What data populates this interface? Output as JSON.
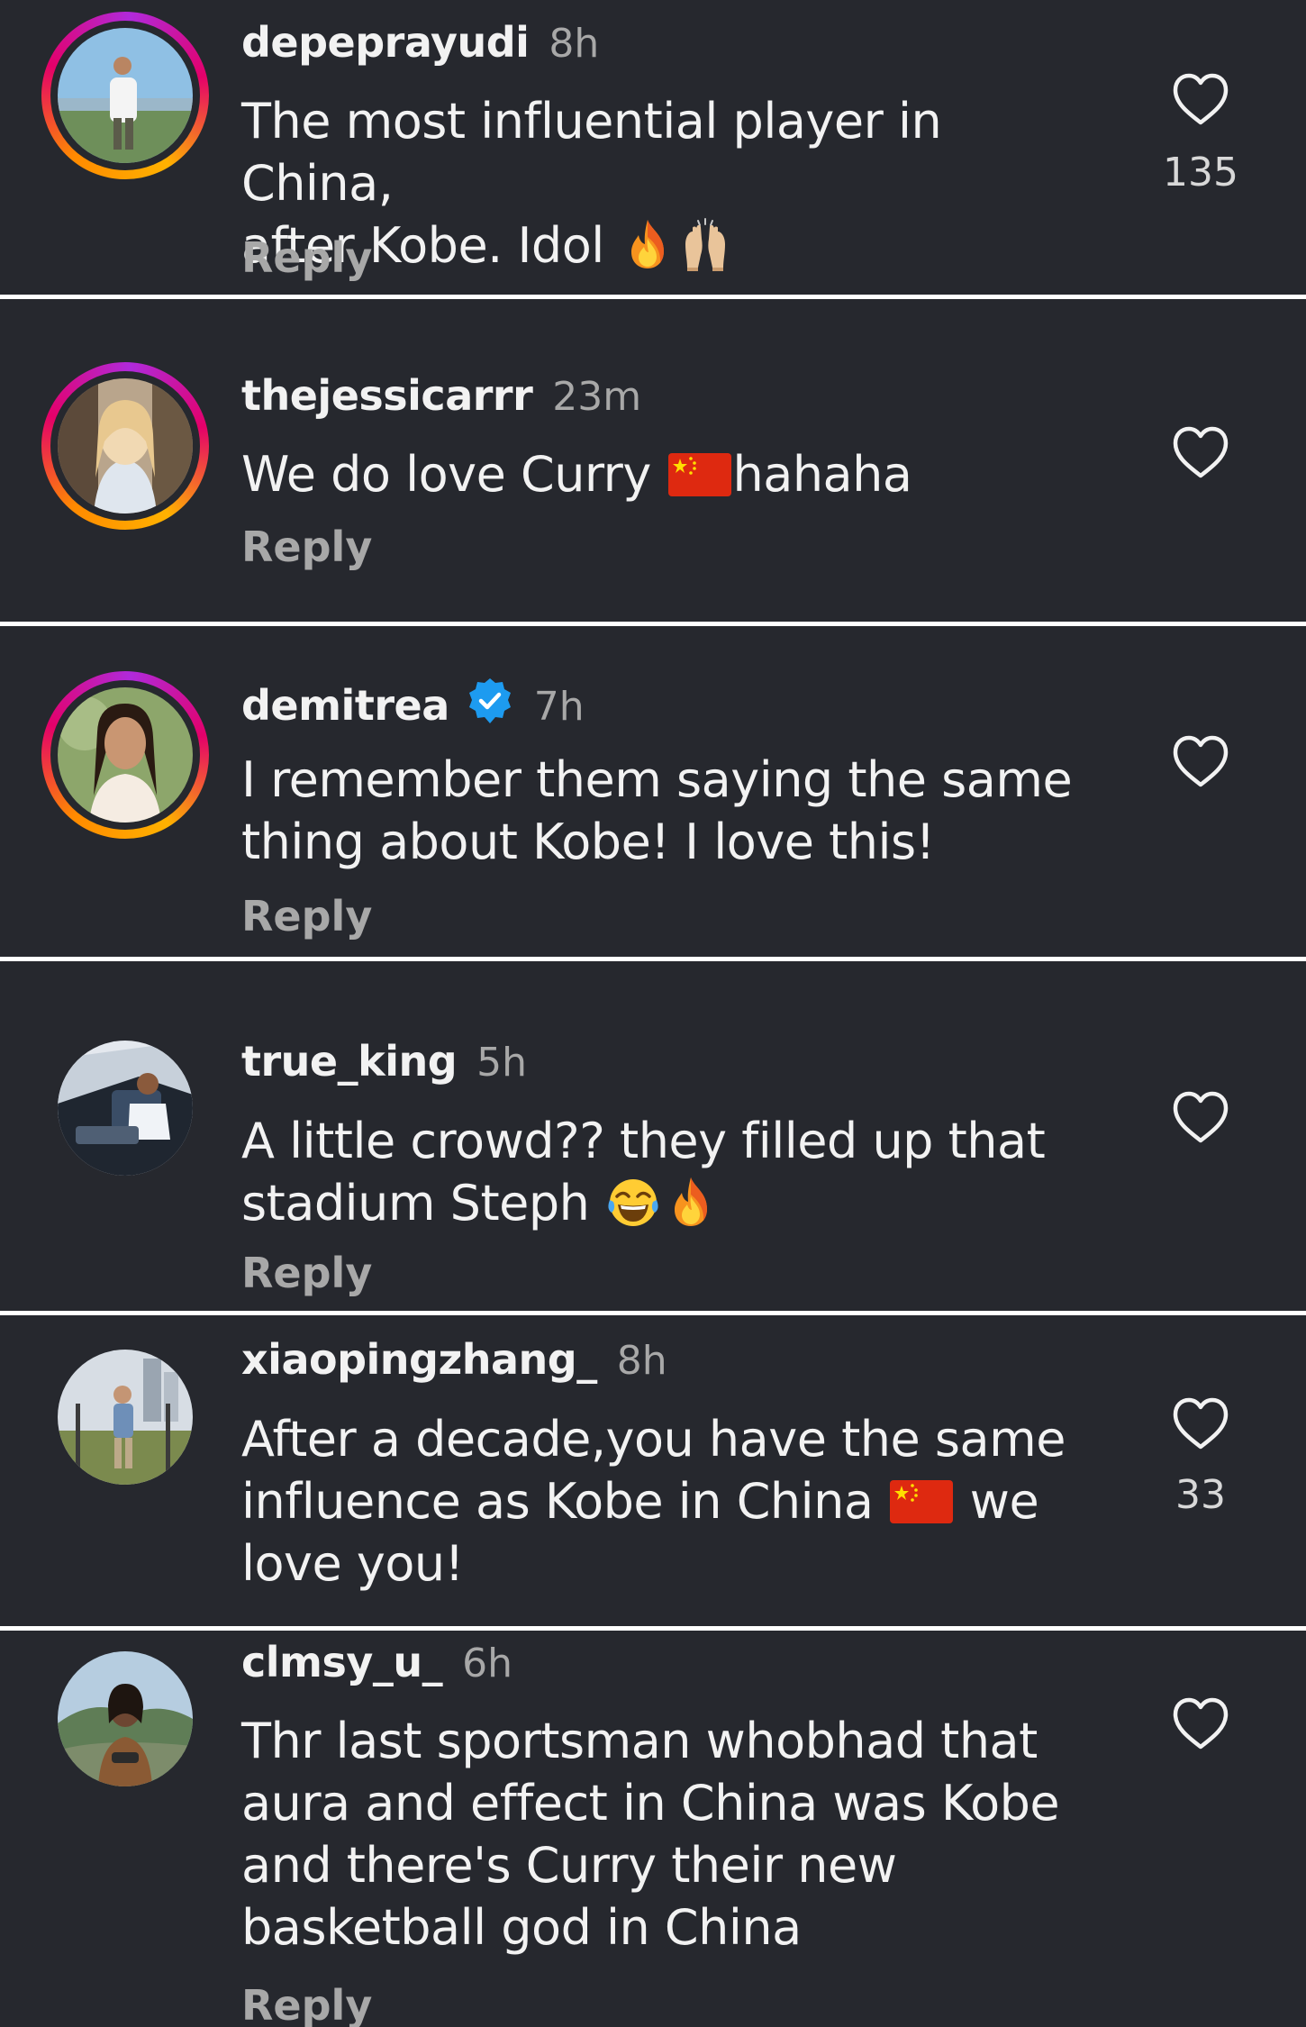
{
  "comments": [
    {
      "username": "depeprayudi",
      "time": "8h",
      "line1": "The most influential player in China,",
      "line2": "after Kobe. Idol",
      "reply": "Reply",
      "likes": "135",
      "emojis": [
        "fire-emoji",
        "raising-hands-emoji"
      ]
    },
    {
      "username": "thejessicarrr",
      "time": "23m",
      "line1a": "We do love Curry",
      "line1b": "hahaha",
      "reply": "Reply",
      "emojis": [
        "china-flag-emoji"
      ]
    },
    {
      "username": "demitrea",
      "time": "7h",
      "line1": "I remember them saying the same",
      "line2": "thing about Kobe! I love this!",
      "reply": "Reply",
      "verified": true
    },
    {
      "username": "true_king",
      "time": "5h",
      "line1": "A little crowd?? they filled up that",
      "line2": "stadium Steph",
      "reply": "Reply",
      "emojis": [
        "tears-of-joy-emoji",
        "fire-emoji"
      ]
    },
    {
      "username": "xiaopingzhang_",
      "time": "8h",
      "line1": "After a decade,you have the same",
      "line2a": "influence as Kobe in China",
      "line2b": "we",
      "line3": "love you!",
      "likes": "33",
      "emojis": [
        "china-flag-emoji"
      ]
    },
    {
      "username": "clmsy_u_",
      "time": "6h",
      "line1": "Thr last sportsman whobhad that",
      "line2": "aura and effect in China was Kobe",
      "line3": "and there's Curry their new",
      "line4": "basketball god in China",
      "reply": "Reply"
    }
  ],
  "colors": {
    "panel": "#26282e",
    "divider": "#ffffff",
    "text": "#f2f2f2",
    "secondary": "#a8a8a8",
    "verified": "#1d9bf0"
  }
}
